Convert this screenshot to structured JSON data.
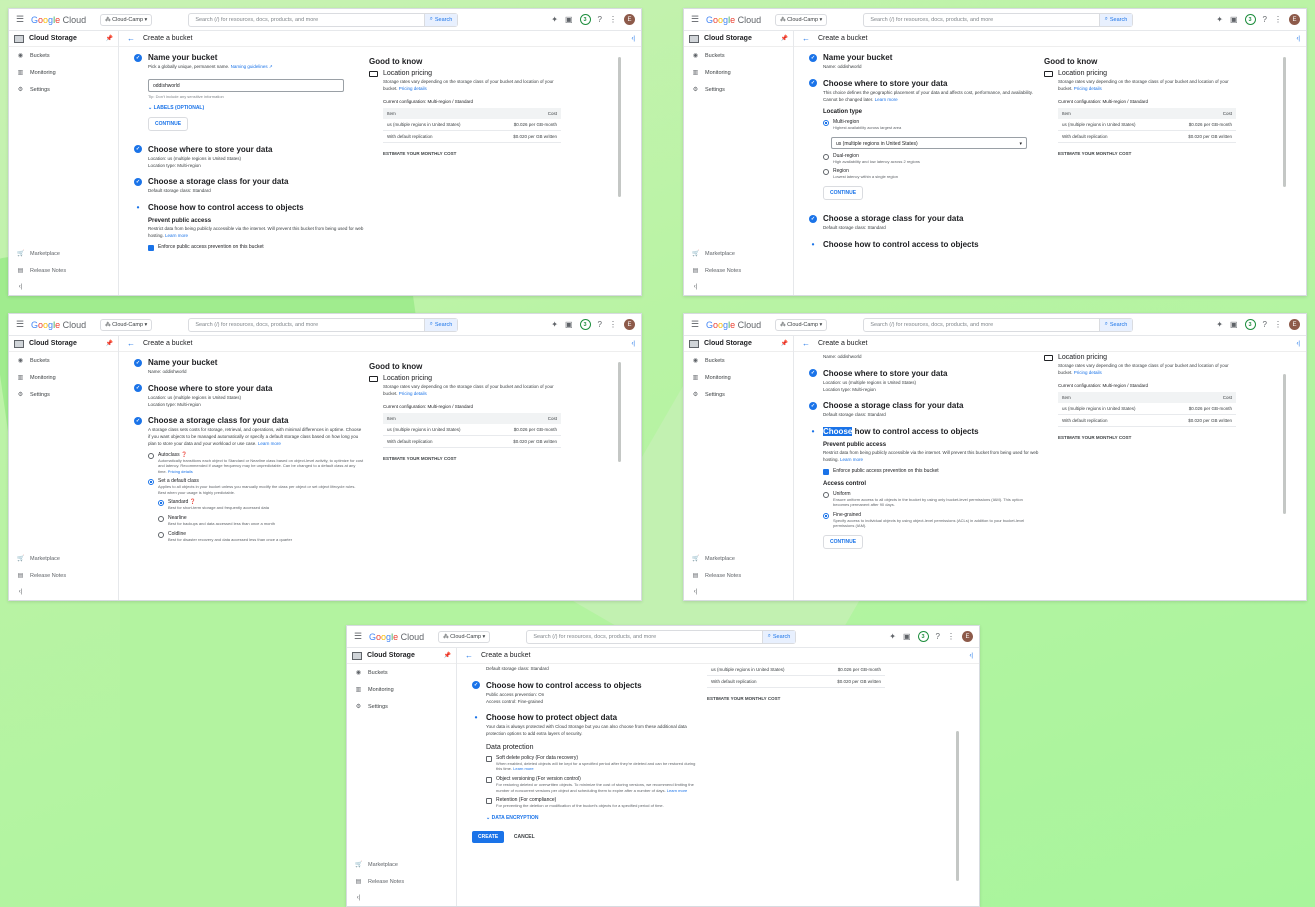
{
  "common": {
    "brand": {
      "google": "Google",
      "cloud": "Cloud"
    },
    "project": "Cloud-Camp",
    "search_placeholder": "Search (/) for resources, docs, products, and more",
    "search_button": "Search",
    "badge_count": "3",
    "avatar_letter": "E",
    "product": "Cloud Storage",
    "page_title": "Create a bucket",
    "nav": {
      "buckets": "Buckets",
      "monitoring": "Monitoring",
      "settings": "Settings",
      "marketplace": "Marketplace",
      "release_notes": "Release Notes"
    },
    "good_to_know": "Good to know",
    "location_pricing": "Location pricing",
    "pricing_text": "Storage rates vary depending on the storage class of your bucket and location of your bucket.",
    "pricing_link": "Pricing details",
    "current_config": "Current configuration: Multi-region / Standard",
    "table_headers": [
      "Item",
      "Cost"
    ],
    "table_rows": [
      [
        "us (multiple regions in United States)",
        "$0.026 per GB-month"
      ],
      [
        "With default replication",
        "$0.020 per GB written"
      ]
    ],
    "estimate": "ESTIMATE YOUR MONTHLY COST",
    "continue": "CONTINUE"
  },
  "step_titles": {
    "name": "Name your bucket",
    "where": "Choose where to store your data",
    "class": "Choose a storage class for your data",
    "access": "Choose how to control access to objects",
    "protect": "Choose how to protect object data"
  },
  "panel1": {
    "name_desc": "Pick a globally unique, permanent name.",
    "naming_link": "Naming guidelines",
    "bucket_value": "oddishworld",
    "tip": "Tip: Don't include any sensitive information",
    "labels_toggle": "LABELS (OPTIONAL)",
    "location": "Location: us (multiple regions in United States)",
    "location_type": "Location type: Multi-region",
    "default_class": "Default storage class: Standard",
    "prevent_heading": "Prevent public access",
    "prevent_text": "Restrict data from being publicly accessible via the internet. Will prevent this bucket from being used for web hosting.",
    "learn_more": "Learn more",
    "enforce_label": "Enforce public access prevention on this bucket"
  },
  "panel2": {
    "name_summary": "Name: oddishworld",
    "where_text": "This choice defines the geographic placement of your data and affects cost, performance, and availability. Cannot be changed later.",
    "learn_more": "Learn more",
    "location_type_heading": "Location type",
    "multi": "Multi-region",
    "multi_desc": "Highest availability across largest area",
    "select_value": "us (multiple regions in United States)",
    "dual": "Dual-region",
    "dual_desc": "High availability and low latency across 2 regions",
    "region": "Region",
    "region_desc": "Lowest latency within a single region",
    "default_class": "Default storage class: Standard"
  },
  "panel3": {
    "name_summary": "Name: oddishworld",
    "location": "Location: us (multiple regions in United States)",
    "location_type": "Location type: Multi-region",
    "class_text": "A storage class sets costs for storage, retrieval, and operations, with minimal differences in uptime. Choose if you want objects to be managed automatically or specify a default storage class based on how long you plan to store your data and your workload or use case.",
    "learn_more": "Learn more",
    "autoclass": "Autoclass",
    "autoclass_desc": "Automatically transitions each object to Standard or Nearline class based on object-level activity, to optimize for cost and latency. Recommended if usage frequency may be unpredictable. Can be changed to a default class at any time.",
    "pricing_details": "Pricing details",
    "set_default": "Set a default class",
    "set_default_desc": "Applies to all objects in your bucket unless you manually modify the class per object or set object lifecycle rules. Best when your usage is highly predictable.",
    "standard": "Standard",
    "standard_desc": "Best for short-term storage and frequently accessed data",
    "nearline": "Nearline",
    "nearline_desc": "Best for backups and data accessed less than once a month",
    "coldline": "Coldline",
    "coldline_desc": "Best for disaster recovery and data accessed less than once a quarter"
  },
  "panel4": {
    "name_summary": "Name: oddishworld",
    "location": "Location: us (multiple regions in United States)",
    "location_type": "Location type: Multi-region",
    "default_class": "Default storage class: Standard",
    "access_highlight": "Choose",
    "access_rest": " how to control access to objects",
    "prevent_heading": "Prevent public access",
    "prevent_text": "Restrict data from being publicly accessible via the internet. Will prevent this bucket from being used for web hosting.",
    "learn_more": "Learn more",
    "enforce_label": "Enforce public access prevention on this bucket",
    "access_control": "Access control",
    "uniform": "Uniform",
    "uniform_desc": "Ensure uniform access to all objects in the bucket by using only bucket-level permissions (IAM). This option becomes permanent after 90 days.",
    "fine": "Fine-grained",
    "fine_desc": "Specify access to individual objects by using object-level permissions (ACLs) in addition to your bucket-level permissions (IAM)."
  },
  "panel5": {
    "default_class": "Default storage class: Standard",
    "access_prevention": "Public access prevention: On",
    "access_control": "Access control: Fine-grained",
    "protect_text": "Your data is always protected with Cloud Storage but you can also choose from these additional data protection options to add extra layers of security.",
    "data_protection": "Data protection",
    "soft": "Soft delete policy (For data recovery)",
    "soft_desc": "When enabled, deleted objects will be kept for a specified period after they're deleted and can be restored during this time.",
    "versioning": "Object versioning (For version control)",
    "versioning_desc": "For restoring deleted or overwritten objects. To minimize the cost of storing versions, we recommend limiting the number of noncurrent versions per object and scheduling them to expire after a number of days.",
    "retention": "Retention (For compliance)",
    "retention_desc": "For preventing the deletion or modification of the bucket's objects for a specified period of time.",
    "learn_more": "Learn more",
    "encryption": "DATA ENCRYPTION",
    "create": "CREATE",
    "cancel": "CANCEL"
  }
}
